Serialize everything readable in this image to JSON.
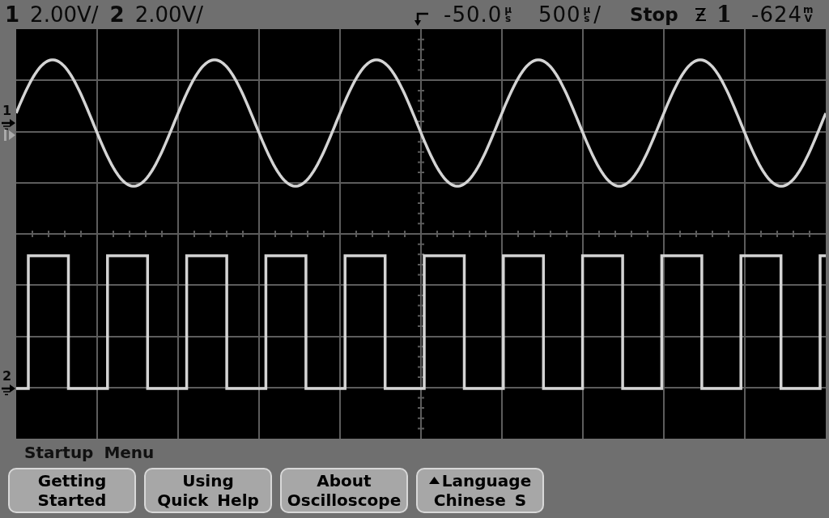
{
  "status_bar": {
    "channels": [
      {
        "number": "1",
        "scale": "2.00V/"
      },
      {
        "number": "2",
        "scale": "2.00V/"
      }
    ],
    "delay": {
      "value": "-50.0",
      "unit": "µs"
    },
    "timebase": {
      "value": "500",
      "unit": "µs",
      "suffix": "/"
    },
    "run_state": "Stop",
    "trigger": {
      "source": "1",
      "level": {
        "value": "-624",
        "unit": "mV"
      }
    }
  },
  "display": {
    "traces": [
      {
        "label": "1",
        "kind": "sine"
      },
      {
        "label": "2",
        "kind": "square"
      }
    ]
  },
  "menu": {
    "title": "Startup Menu",
    "softkeys": [
      {
        "kind": "action",
        "lines": [
          "Getting",
          "Started"
        ]
      },
      {
        "kind": "action",
        "lines": [
          "Using",
          "Quick Help"
        ]
      },
      {
        "kind": "action",
        "lines": [
          "About",
          "Oscilloscope"
        ]
      },
      {
        "kind": "menu",
        "lines": [
          "Language",
          "Chinese S"
        ]
      }
    ]
  }
}
